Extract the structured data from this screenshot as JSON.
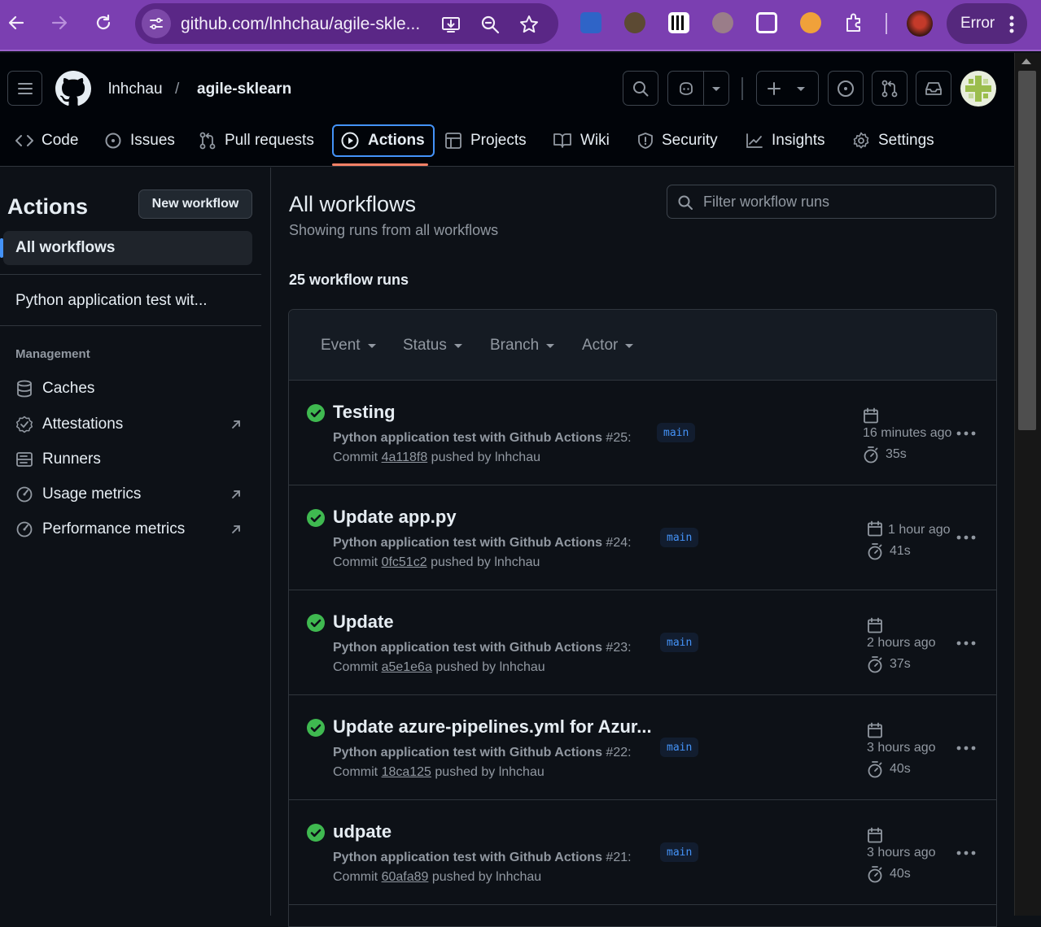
{
  "browser": {
    "url": "github.com/lnhchau/agile-skle...",
    "error_label": "Error"
  },
  "header": {
    "owner": "lnhchau",
    "separator": "/",
    "repo": "agile-sklearn"
  },
  "tabs": [
    {
      "label": "Code"
    },
    {
      "label": "Issues"
    },
    {
      "label": "Pull requests"
    },
    {
      "label": "Actions"
    },
    {
      "label": "Projects"
    },
    {
      "label": "Wiki"
    },
    {
      "label": "Security"
    },
    {
      "label": "Insights"
    },
    {
      "label": "Settings"
    }
  ],
  "sidebar": {
    "title": "Actions",
    "new_workflow_label": "New workflow",
    "all_workflows_label": "All workflows",
    "workflow_item": "Python application test wit...",
    "management_heading": "Management",
    "items": [
      {
        "label": "Caches"
      },
      {
        "label": "Attestations"
      },
      {
        "label": "Runners"
      },
      {
        "label": "Usage metrics"
      },
      {
        "label": "Performance metrics"
      }
    ]
  },
  "main": {
    "title": "All workflows",
    "subtitle": "Showing runs from all workflows",
    "filter_placeholder": "Filter workflow runs",
    "run_count": "25 workflow runs",
    "facets": {
      "event": "Event",
      "status": "Status",
      "branch": "Branch",
      "actor": "Actor"
    },
    "runs": [
      {
        "title": "Testing",
        "workflow": "Python application test with Github Actions",
        "number": "#25:",
        "commit_prefix": "Commit",
        "sha": "4a118f8",
        "pushed_by": "pushed by lnhchau",
        "branch": "main",
        "time": "16 minutes ago",
        "duration": "35s"
      },
      {
        "title": "Update app.py",
        "workflow": "Python application test with Github Actions",
        "number": "#24:",
        "commit_prefix": "Commit",
        "sha": "0fc51c2",
        "pushed_by": "pushed by lnhchau",
        "branch": "main",
        "time": "1 hour ago",
        "duration": "41s"
      },
      {
        "title": "Update",
        "workflow": "Python application test with Github Actions",
        "number": "#23:",
        "commit_prefix": "Commit",
        "sha": "a5e1e6a",
        "pushed_by": "pushed by lnhchau",
        "branch": "main",
        "time": "2 hours ago",
        "duration": "37s"
      },
      {
        "title": "Update azure-pipelines.yml for Azur...",
        "workflow": "Python application test with Github Actions",
        "number": "#22:",
        "commit_prefix": "Commit",
        "sha": "18ca125",
        "pushed_by": "pushed by lnhchau",
        "branch": "main",
        "time": "3 hours ago",
        "duration": "40s"
      },
      {
        "title": "udpate",
        "workflow": "Python application test with Github Actions",
        "number": "#21:",
        "commit_prefix": "Commit",
        "sha": "60afa89",
        "pushed_by": "pushed by lnhchau",
        "branch": "main",
        "time": "3 hours ago",
        "duration": "40s"
      }
    ]
  },
  "colors": {
    "bg": "#0d1117",
    "header_bg": "#010409",
    "accent": "#4493f8",
    "success": "#3fb950",
    "tab_underline": "#f78166",
    "browser_frame": "#7b3fb1"
  }
}
